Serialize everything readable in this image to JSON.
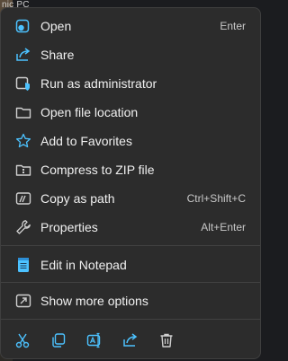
{
  "background": {
    "text": "nic PC"
  },
  "menu": {
    "items": [
      {
        "label": "Open",
        "shortcut": "Enter",
        "icon": "open-app-icon"
      },
      {
        "label": "Share",
        "shortcut": "",
        "icon": "share-icon"
      },
      {
        "label": "Run as administrator",
        "shortcut": "",
        "icon": "admin-shield-icon"
      },
      {
        "label": "Open file location",
        "shortcut": "",
        "icon": "folder-icon"
      },
      {
        "label": "Add to Favorites",
        "shortcut": "",
        "icon": "star-icon"
      },
      {
        "label": "Compress to ZIP file",
        "shortcut": "",
        "icon": "zip-folder-icon"
      },
      {
        "label": "Copy as path",
        "shortcut": "Ctrl+Shift+C",
        "icon": "copy-path-icon"
      },
      {
        "label": "Properties",
        "shortcut": "Alt+Enter",
        "icon": "wrench-icon"
      }
    ],
    "edit_item": {
      "label": "Edit in Notepad",
      "icon": "notepad-icon"
    },
    "more_item": {
      "label": "Show more options",
      "icon": "more-options-icon"
    },
    "bottom_actions": [
      "cut-icon",
      "copy-icon",
      "rename-icon",
      "share-icon",
      "delete-icon"
    ]
  },
  "colors": {
    "accent": "#4cc2ff",
    "menu_bg": "#2c2c2c",
    "text": "#f0f0f0"
  }
}
